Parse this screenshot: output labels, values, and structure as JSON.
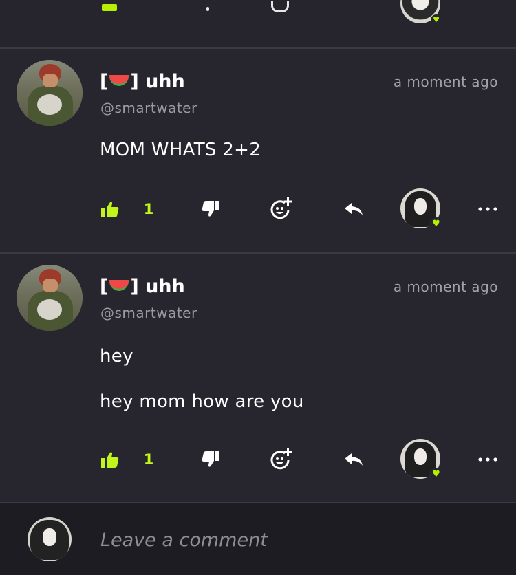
{
  "colors": {
    "background": "#27262e",
    "accent": "#c2f51b",
    "divider": "#3b3a43",
    "comment_bar": "#1d1c22"
  },
  "posts": [
    {
      "username_prefix": "[",
      "username_emoji": "watermelon",
      "username_suffix": "] uhh",
      "handle": "@smartwater",
      "time": "a moment ago",
      "lines": [
        "MOM WHATS 2+2"
      ],
      "like_count": "1",
      "liked": true,
      "reactor_icon": "heart-icon"
    },
    {
      "username_prefix": "[",
      "username_emoji": "watermelon",
      "username_suffix": "] uhh",
      "handle": "@smartwater",
      "time": "a moment ago",
      "lines": [
        "hey",
        "hey mom how are you"
      ],
      "like_count": "1",
      "liked": true,
      "reactor_icon": "heart-icon"
    }
  ],
  "comment_box": {
    "placeholder": "Leave a comment"
  }
}
